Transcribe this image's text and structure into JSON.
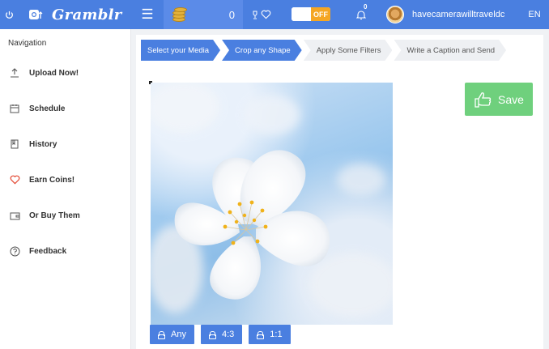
{
  "header": {
    "app_name": "Gramblr",
    "coins": "0",
    "toggle_state": "OFF",
    "notification_count": "0",
    "username": "havecamerawilltraveldc",
    "language": "EN"
  },
  "sidebar": {
    "title": "Navigation",
    "items": [
      {
        "label": "Upload Now!",
        "icon": "upload-icon"
      },
      {
        "label": "Schedule",
        "icon": "calendar-icon"
      },
      {
        "label": "History",
        "icon": "history-icon"
      },
      {
        "label": "Earn Coins!",
        "icon": "heart-icon"
      },
      {
        "label": "Or Buy Them",
        "icon": "wallet-icon"
      },
      {
        "label": "Feedback",
        "icon": "help-icon"
      }
    ]
  },
  "steps": [
    {
      "label": "Select your Media",
      "active": true
    },
    {
      "label": "Crop any Shape",
      "active": true
    },
    {
      "label": "Apply Some Filters",
      "active": false
    },
    {
      "label": "Write a Caption and Send",
      "active": false
    }
  ],
  "editor": {
    "save_label": "Save",
    "ratios": [
      "Any",
      "4:3",
      "1:1"
    ]
  },
  "colors": {
    "accent": "#4a7fe0",
    "save": "#6fd07d",
    "toggle": "#f5a623",
    "heart": "#e2452f"
  }
}
